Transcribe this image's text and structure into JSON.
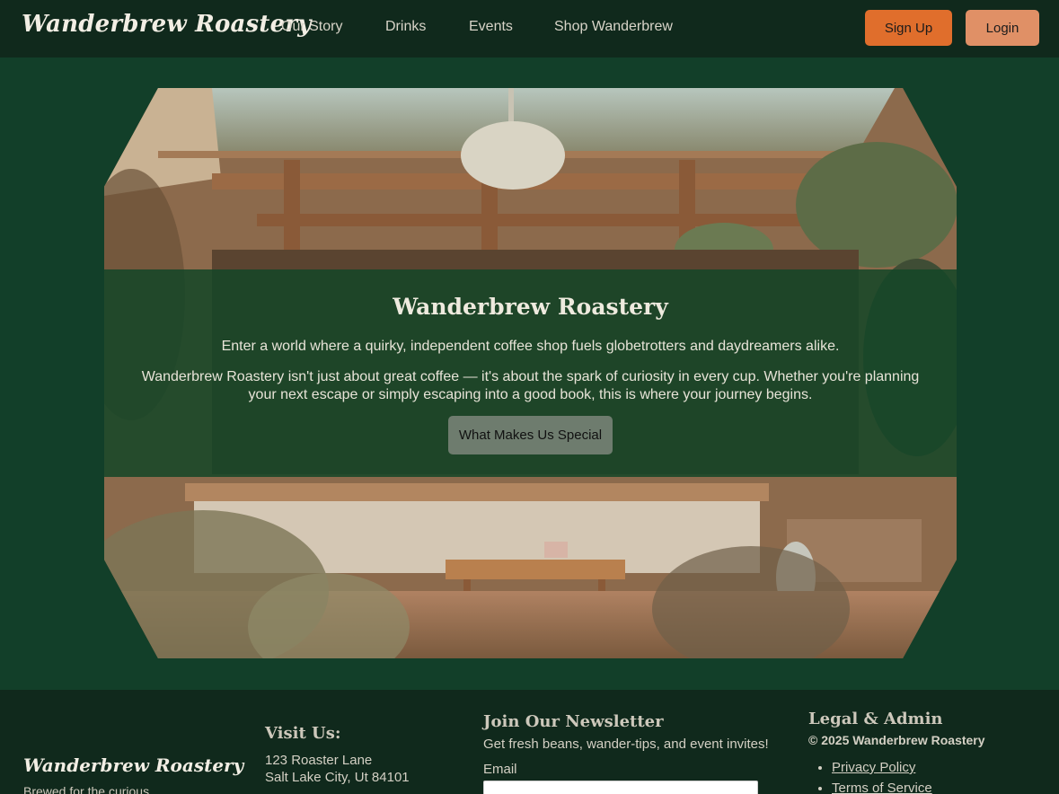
{
  "nav": {
    "brand": "Wanderbrew Roastery",
    "links": [
      "Our Story",
      "Drinks",
      "Events",
      "Shop Wanderbrew"
    ],
    "signup_label": "Sign Up",
    "login_label": "Login"
  },
  "hero": {
    "title": "Wanderbrew Roastery",
    "subtitle": "Enter a world where a quirky, independent coffee shop fuels globetrotters and daydreamers alike.",
    "description": "Wanderbrew Roastery isn't just about great coffee — it's about the spark of curiosity in every cup. Whether you're planning your next escape or simply escaping into a good book, this is where your journey begins.",
    "cta_label": "What Makes Us Special"
  },
  "footer": {
    "brand": "Wanderbrew Roastery",
    "tagline": "Brewed for the curious",
    "visit": {
      "heading": "Visit Us:",
      "address_line1": "123 Roaster Lane",
      "address_line2": "Salt Lake City, Ut 84101"
    },
    "newsletter": {
      "heading": "Join Our Newsletter",
      "text": "Get fresh beans, wander-tips, and event invites!",
      "email_label": "Email",
      "email_value": ""
    },
    "legal": {
      "heading": "Legal & Admin",
      "copyright": "© 2025 Wanderbrew Roastery",
      "links": [
        "Privacy Policy",
        "Terms of Service"
      ]
    }
  },
  "colors": {
    "nav_bg": "#10291c",
    "page_bg": "#123f29",
    "signup": "#e06e2c",
    "login": "#e09066"
  }
}
